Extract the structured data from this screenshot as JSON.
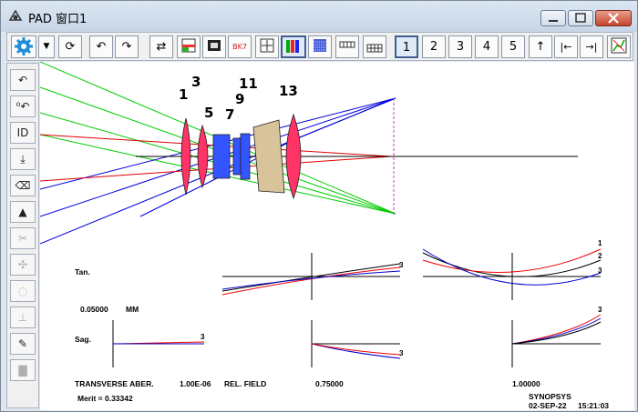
{
  "window": {
    "title": "PAD 窗口1",
    "accent_color": "#c4432c"
  },
  "toolbar": {
    "items": [
      {
        "name": "settings-gear-icon",
        "label": ""
      },
      {
        "name": "dropdown-arrow-icon",
        "label": "▼"
      },
      {
        "name": "refresh-icon",
        "label": "⟳"
      },
      {
        "name": "undo-icon",
        "label": "↶"
      },
      {
        "name": "redo-icon",
        "label": "↷"
      },
      {
        "name": "swap-icon",
        "label": "⇄"
      },
      {
        "name": "layout-icon",
        "label": ""
      },
      {
        "name": "film-icon",
        "label": ""
      },
      {
        "name": "glass-bk7-icon",
        "label": "BK7"
      },
      {
        "name": "fit-icon",
        "label": ""
      },
      {
        "name": "color-bars-icon",
        "label": ""
      },
      {
        "name": "pattern-icon",
        "label": ""
      },
      {
        "name": "keyboard-icon",
        "label": ""
      },
      {
        "name": "keypad-icon",
        "label": ""
      }
    ],
    "numbers": [
      "1",
      "2",
      "3",
      "4",
      "5"
    ],
    "arrows": [
      "↑",
      "|←",
      "→|"
    ]
  },
  "sidebar": {
    "items": [
      {
        "name": "undo-icon",
        "label": "↶",
        "enabled": true
      },
      {
        "name": "zero-icon",
        "label": "⁰↶",
        "enabled": true
      },
      {
        "name": "id-icon",
        "label": "ID",
        "enabled": true
      },
      {
        "name": "download-icon",
        "label": "⤓",
        "enabled": true
      },
      {
        "name": "eraser-icon",
        "label": "⌫",
        "enabled": true
      },
      {
        "name": "triangle-icon",
        "label": "▲",
        "enabled": true
      },
      {
        "name": "scissors-icon",
        "label": "✂",
        "enabled": false
      },
      {
        "name": "move-icon",
        "label": "✣",
        "enabled": false
      },
      {
        "name": "circle-icon",
        "label": "◌",
        "enabled": false
      },
      {
        "name": "split-icon",
        "label": "⊥",
        "enabled": false
      },
      {
        "name": "pencil-icon",
        "label": "✎",
        "enabled": true
      },
      {
        "name": "stamp-icon",
        "label": "▇",
        "enabled": false
      }
    ]
  },
  "lens": {
    "surface_labels": [
      "1",
      "3",
      "5",
      "7",
      "9",
      "11",
      "13"
    ],
    "ray_colors": {
      "axial": "#ff0000",
      "mid": "#00cc00",
      "edge": "#0000ff"
    },
    "glass_colors": {
      "crown": "#ff3366",
      "flint": "#3355ff",
      "cement": "#d9c39a"
    }
  },
  "aberration": {
    "tan_label": "Tan.",
    "sag_label": "Sag.",
    "scale_value": "0.05000",
    "scale_unit": "MM",
    "footer_label": "TRANSVERSE ABER.",
    "footer_value": "1.00E-06",
    "rel_field_label": "REL. FIELD",
    "field_mid": "0.75000",
    "field_full": "1.00000",
    "merit": "Merit = 0.33342",
    "brand": "SYNOPSYS",
    "date": "02-SEP-22",
    "time": "15:21:03",
    "curve_labels": [
      "1",
      "2",
      "3"
    ]
  }
}
